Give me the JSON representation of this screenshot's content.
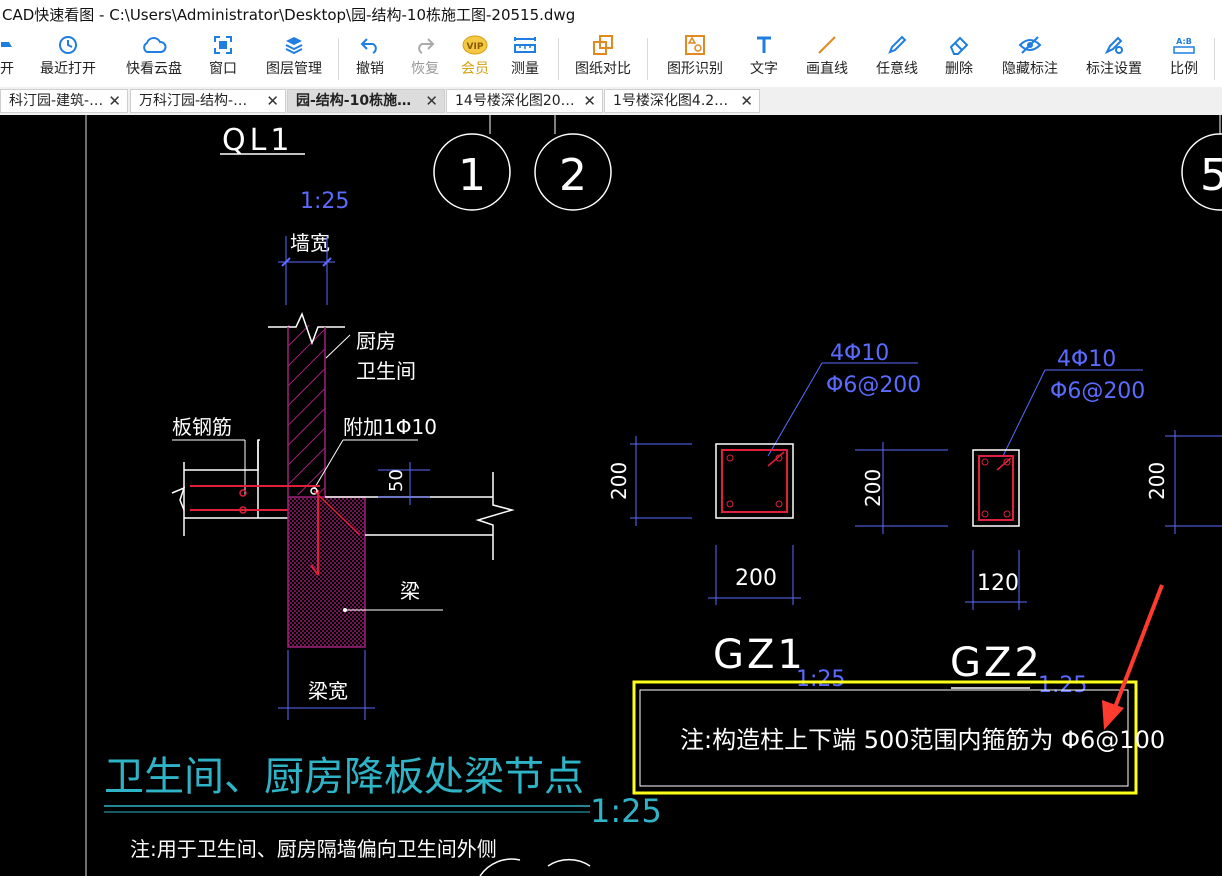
{
  "window": {
    "title": "CAD快速看图 - C:\\Users\\Administrator\\Desktop\\园-结构-10栋施工图-20515.dwg"
  },
  "toolbar": {
    "open": "开",
    "recent": "最近打开",
    "cloud": "快看云盘",
    "window": "窗口",
    "layers": "图层管理",
    "undo": "撤销",
    "redo": "恢复",
    "vip": "会员",
    "measure": "测量",
    "compare": "图纸对比",
    "recognize": "图形识别",
    "text": "文字",
    "line": "画直线",
    "freeline": "任意线",
    "delete": "删除",
    "hide": "隐藏标注",
    "annot_settings": "标注设置",
    "scale": "比例"
  },
  "tabs": [
    {
      "label": "科汀园-建筑-…"
    },
    {
      "label": "万科汀园-结构-…"
    },
    {
      "label": "园-结构-10栋施…"
    },
    {
      "label": "14号楼深化图20…"
    },
    {
      "label": "1号楼深化图4.2…"
    }
  ],
  "drawing": {
    "top_label": "QL1",
    "axis_1": "1",
    "axis_2": "2",
    "axis_5": "5",
    "scale_detail": "1:25",
    "wall_width": "墙宽",
    "kitchen_1": "厨房",
    "kitchen_2": "卫生间",
    "slab_rebar": "板钢筋",
    "extra_rebar": "附加1Φ10",
    "dim_50": "50",
    "beam": "梁",
    "beam_width": "梁宽",
    "title_node": "卫生间、厨房降板处梁节点",
    "title_scale": "1:25",
    "note_bottom": "注:用于卫生间、厨房隔墙偏向卫生间外侧",
    "gz1_main": "4Φ10",
    "gz1_stirrup": "Φ6@200",
    "gz2_main": "4Φ10",
    "gz2_stirrup": "Φ6@200",
    "dim_200_a": "200",
    "dim_200_b": "200",
    "dim_200_c": "200",
    "dim_200_h": "200",
    "dim_120": "120",
    "gz1_label": "GZ1",
    "gz1_scale": "1:25",
    "gz2_label": "GZ2",
    "gz2_scale": "1:25",
    "note_highlight": "注:构造柱上下端 500范围内箍筋为 Φ6@100"
  },
  "colors": {
    "background": "#000000",
    "blue_line": "#5b6bff",
    "cyan_text": "#2fb3c6",
    "red_rebar": "#e0203a",
    "magenta_hatch": "#a0207a",
    "highlight_box": "#ffff1a",
    "annot_arrow": "#ff3b30"
  }
}
